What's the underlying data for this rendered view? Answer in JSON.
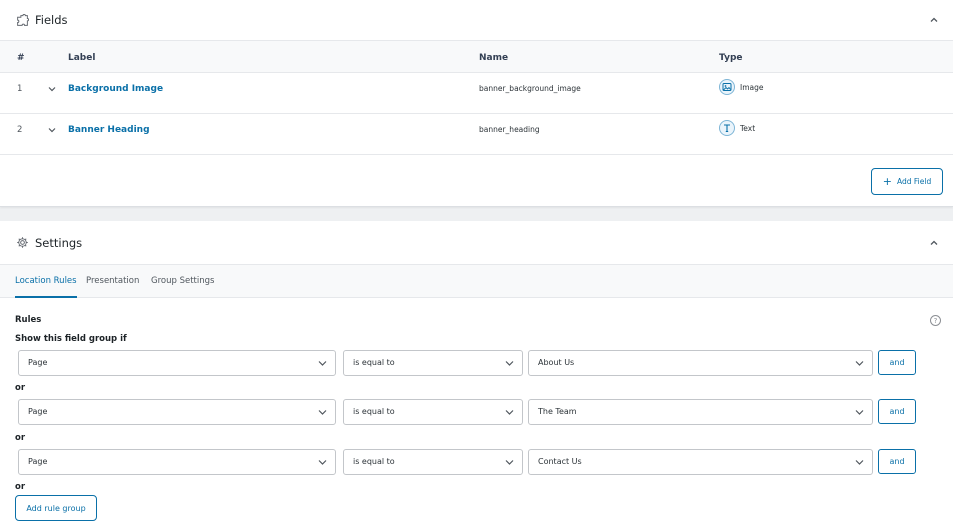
{
  "fields": {
    "title": "Fields",
    "icon": "puzzle-icon",
    "headers": {
      "num": "#",
      "label": "Label",
      "name": "Name",
      "type": "Type"
    },
    "rows": [
      {
        "num": "1",
        "label": "Background Image",
        "name": "banner_background_image",
        "type": "Image",
        "type_icon": "image-icon"
      },
      {
        "num": "2",
        "label": "Banner Heading",
        "name": "banner_heading",
        "type": "Text",
        "type_icon": "text-icon"
      }
    ],
    "add_label": "Add Field"
  },
  "settings": {
    "title": "Settings",
    "icon": "gear-icon",
    "tabs": [
      "Location Rules",
      "Presentation",
      "Group Settings"
    ],
    "active_tab": "Location Rules",
    "rules_title": "Rules",
    "show_if": "Show this field group if",
    "rules": [
      {
        "param": "Page",
        "operator": "is equal to",
        "value": "About Us",
        "and": "and"
      },
      {
        "param": "Page",
        "operator": "is equal to",
        "value": "The Team",
        "and": "and"
      },
      {
        "param": "Page",
        "operator": "is equal to",
        "value": "Contact Us",
        "and": "and"
      }
    ],
    "or_label": "or",
    "add_group_label": "Add rule group",
    "help": "?"
  },
  "colors": {
    "accent": "#0a70a8",
    "border": "#c3c6ca",
    "background": "#eef0f2"
  }
}
